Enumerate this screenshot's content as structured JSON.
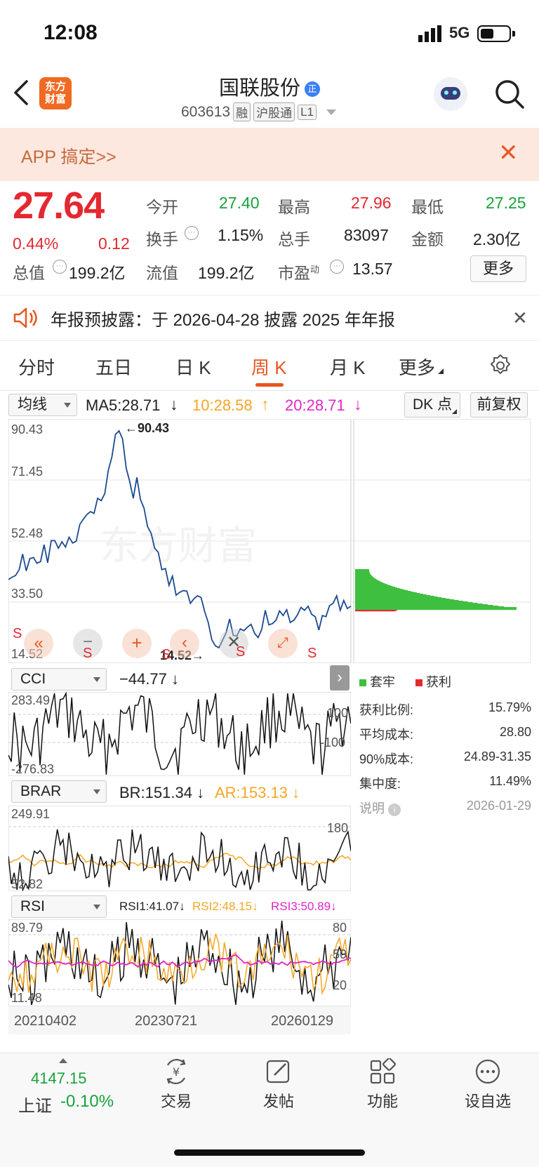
{
  "status_bar": {
    "time": "12:08",
    "network": "5G",
    "battery_level": 0.45
  },
  "header": {
    "logo_text": "东方财富",
    "stock_name": "国联股份",
    "stock_code": "603613",
    "tags": [
      "融",
      "沪股通",
      "L1"
    ]
  },
  "banner": {
    "text": "APP 搞定>>"
  },
  "quote": {
    "price": "27.64",
    "change_pct": "0.44%",
    "change": "0.12",
    "rows": [
      {
        "label": "今开",
        "value": "27.40",
        "label2": "最高",
        "value2": "27.96",
        "label3": "最低",
        "value3": "27.25"
      },
      {
        "label": "换手",
        "value": "1.15%",
        "label2": "总手",
        "value2": "83097",
        "label3": "金额",
        "value3": "2.30亿"
      },
      {
        "label": "总值",
        "value": "199.2亿",
        "label2": "流值",
        "value2": "199.2亿",
        "label3": "市盈",
        "label3_sup": "动",
        "value3": "13.57"
      }
    ],
    "more_label": "更多"
  },
  "notice": {
    "text": "年报预披露：于 2026-04-28 披露 2025 年年报"
  },
  "tabs": [
    {
      "label": "分时",
      "active": false
    },
    {
      "label": "五日",
      "active": false
    },
    {
      "label": "日 K",
      "active": false
    },
    {
      "label": "周 K",
      "active": true
    },
    {
      "label": "月 K",
      "active": false
    },
    {
      "label": "更多",
      "active": false
    }
  ],
  "chart_toolbar": {
    "ma_select": "均线",
    "ma5": "MA5:28.71",
    "ma10": "10:28.58",
    "ma20": "20:28.71",
    "dk_label": "DK 点",
    "adjust_label": "前复权"
  },
  "chart_data": {
    "type": "line",
    "title": "",
    "price_axis_ticks": [
      "90.43",
      "71.45",
      "52.48",
      "33.50",
      "14.52"
    ],
    "max_label": "90.43",
    "min_label": "14.52",
    "x_labels": [
      "20210402",
      "20230721",
      "20260129"
    ],
    "ylim": [
      14.52,
      90.43
    ],
    "series": [
      {
        "values": [
          38,
          40,
          37,
          42,
          45,
          41,
          44,
          48,
          43,
          46,
          50,
          45,
          49,
          52,
          47,
          51,
          48,
          55,
          50,
          53,
          57,
          60,
          58,
          62,
          59,
          66,
          64,
          70,
          75,
          82,
          88,
          90.43,
          84,
          77,
          70,
          66,
          72,
          68,
          62,
          58,
          54,
          50,
          45,
          42,
          40,
          36,
          38,
          35,
          33,
          36,
          34,
          31,
          29,
          33,
          30,
          27,
          22,
          18,
          15,
          14.52,
          17,
          20,
          22,
          19,
          18,
          21,
          20,
          24,
          22,
          20,
          18,
          22,
          25,
          23,
          21,
          24,
          26,
          28,
          27,
          25,
          24,
          27,
          26,
          28,
          27,
          26,
          24,
          23,
          25,
          27,
          29,
          31,
          30,
          28,
          29,
          28,
          27.64
        ]
      }
    ],
    "chip_distribution": {
      "profit_ratio": "15.79%",
      "avg_cost": "28.80",
      "cost_90": "24.89-31.35",
      "concentration": "11.49%",
      "date": "2026-01-29"
    },
    "indicators": {
      "cci": {
        "name": "CCI",
        "value": "−44.77",
        "max": "283.49",
        "min": "-276.83",
        "level_hi": "100",
        "level_lo": "-100"
      },
      "brar": {
        "name": "BRAR",
        "br": "BR:151.34",
        "ar": "AR:153.13",
        "max": "249.91",
        "min": "52.82",
        "level": "180"
      },
      "rsi": {
        "name": "RSI",
        "rsi1": "RSI1:41.07",
        "rsi2": "RSI2:48.15",
        "rsi3": "RSI3:50.89",
        "max": "89.79",
        "min": "11.48",
        "level_hi": "80",
        "level_mid": "50",
        "level_lo": "20"
      }
    }
  },
  "chip_panel": {
    "legend_trapped": "套牢",
    "legend_profit": "获利",
    "rows": [
      {
        "label": "获利比例:",
        "value": "15.79%"
      },
      {
        "label": "平均成本:",
        "value": "28.80"
      },
      {
        "label": "90%成本:",
        "value": "24.89-31.35"
      },
      {
        "label": "集中度:",
        "value": "11.49%"
      }
    ],
    "note_label": "说明",
    "note_date": "2026-01-29"
  },
  "overlay_buttons": [
    "S",
    "S",
    "S",
    "S",
    "S"
  ],
  "bottom_nav": {
    "index_value": "4147.15",
    "index_name": "上证",
    "index_change": "-0.10%",
    "items": [
      "交易",
      "发帖",
      "功能",
      "设自选"
    ]
  },
  "colors": {
    "up": "#e4282f",
    "down": "#18a33a",
    "accent": "#e8551f",
    "line": "#1c4b8f"
  }
}
